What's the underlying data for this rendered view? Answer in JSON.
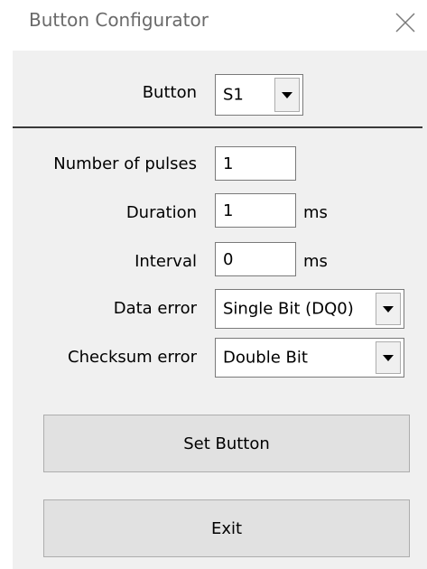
{
  "window": {
    "title": "Button Configurator",
    "close_icon": "close-icon"
  },
  "button_select": {
    "label": "Button",
    "value": "S1"
  },
  "pulses": {
    "label": "Number of pulses",
    "value": "1"
  },
  "duration": {
    "label": "Duration",
    "value": "1",
    "unit": "ms"
  },
  "interval": {
    "label": "Interval",
    "value": "0",
    "unit": "ms"
  },
  "data_error": {
    "label": "Data error",
    "value": "Single Bit (DQ0)"
  },
  "checksum_error": {
    "label": "Checksum error",
    "value": "Double Bit"
  },
  "actions": {
    "set_button": "Set Button",
    "exit": "Exit"
  },
  "colors": {
    "client_bg": "#f0f0f0",
    "button_bg": "#e1e1e1",
    "border": "#7a7a7a"
  }
}
